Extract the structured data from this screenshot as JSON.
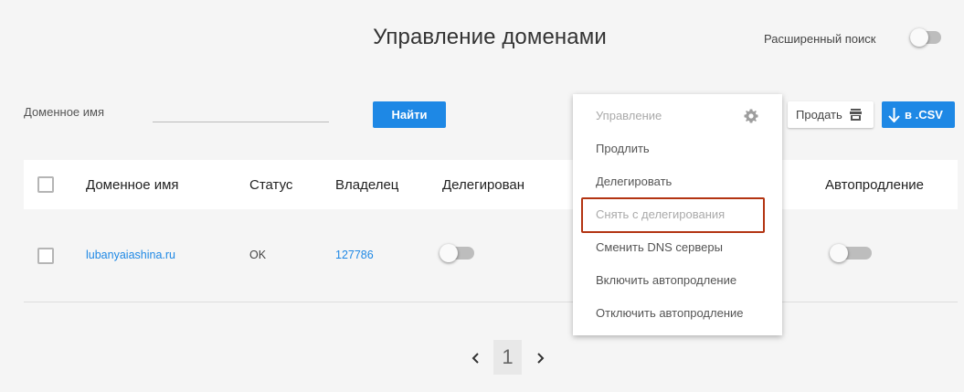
{
  "header": {
    "title": "Управление доменами",
    "advanced_search_label": "Расширенный поиск"
  },
  "search": {
    "label": "Доменное имя",
    "value": "",
    "find_button": "Найти"
  },
  "toolbar": {
    "sell_label": "Продать",
    "csv_label": "в .CSV"
  },
  "table": {
    "headers": {
      "domain": "Доменное имя",
      "status": "Статус",
      "owner": "Владелец",
      "delegated": "Делегирован",
      "autorenew": "Автопродление"
    },
    "rows": [
      {
        "domain": "lubanyaiashina.ru",
        "status": "OK",
        "owner": "127786",
        "delegated": false,
        "autorenew": false
      }
    ]
  },
  "dropdown": {
    "items": [
      {
        "label": "Управление",
        "disabled": true
      },
      {
        "label": "Продлить",
        "disabled": false
      },
      {
        "label": "Делегировать",
        "disabled": false
      },
      {
        "label": "Снять с делегирования",
        "disabled": true
      },
      {
        "label": "Сменить DNS серверы",
        "disabled": false
      },
      {
        "label": "Включить автопродление",
        "disabled": false
      },
      {
        "label": "Отключить автопродление",
        "disabled": false
      }
    ]
  },
  "pagination": {
    "current_page": "1"
  },
  "colors": {
    "primary": "#1e88e5",
    "highlight": "#b33412"
  }
}
